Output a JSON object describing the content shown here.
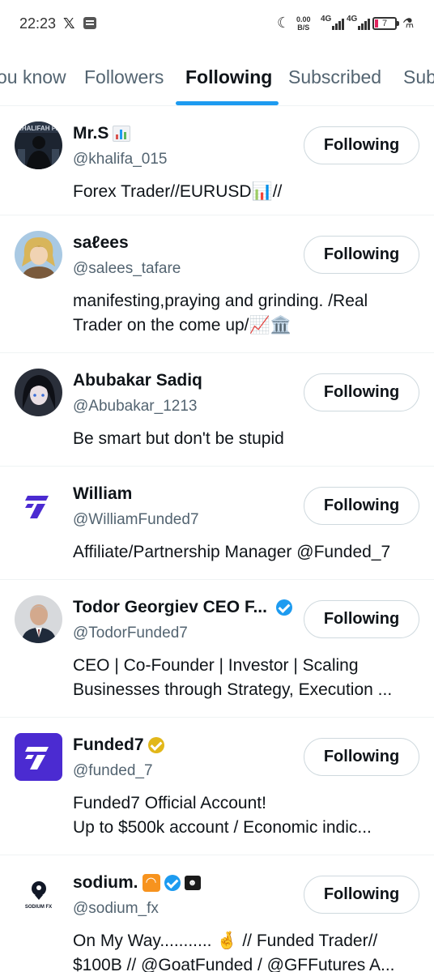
{
  "status_bar": {
    "time": "22:23",
    "x_icon": "x-logo-icon",
    "net_speed_value": "0.00",
    "net_speed_unit": "B/S",
    "network_1": "4G",
    "network_2": "4G",
    "battery": "7"
  },
  "tabs": [
    {
      "label": "ou know",
      "active": false
    },
    {
      "label": "Followers",
      "active": false
    },
    {
      "label": "Following",
      "active": true
    },
    {
      "label": "Subscribed",
      "active": false
    },
    {
      "label": "Sub",
      "active": false
    }
  ],
  "accent_color": "#1d9bf0",
  "users": [
    {
      "name": "Mr.S",
      "name_emoji": "chart-emoji",
      "handle": "@khalifa_015",
      "bio_lines": [
        "Forex Trader//EURUSD📊//"
      ],
      "button": "Following",
      "avatar_text": "KHALIFAH FX"
    },
    {
      "name": "saℓees",
      "handle": "@salees_tafare",
      "bio_lines": [
        "manifesting,praying and grinding. /Real",
        "Trader on the come up/📈🏛️"
      ],
      "button": "Following"
    },
    {
      "name": "Abubakar Sadiq",
      "handle": "@Abubakar_1213",
      "bio_lines": [
        "Be smart but don't be stupid"
      ],
      "button": "Following"
    },
    {
      "name": "William",
      "handle": "@WilliamFunded7",
      "bio_lines": [
        "Affiliate/Partnership Manager @Funded_7"
      ],
      "button": "Following"
    },
    {
      "name": "Todor Georgiev CEO F...",
      "verified": "blue",
      "handle": "@TodorFunded7",
      "bio_lines": [
        "CEO | Co-Founder | Investor | Scaling",
        "Businesses through Strategy, Execution ..."
      ],
      "button": "Following"
    },
    {
      "name": "Funded7",
      "verified": "gold",
      "handle": "@funded_7",
      "bio_lines": [
        "Funded7 Official Account!",
        "Up to $500k  account / Economic indic..."
      ],
      "button": "Following"
    },
    {
      "name": "sodium.",
      "verified": "blue",
      "handle": "@sodium_fx",
      "bio_lines": [
        "On My Way........... 🤞 // Funded Trader//",
        "$100B // @GoatFunded / @GFFutures A..."
      ],
      "button": "Following",
      "avatar_text": "SODIUM FX"
    }
  ]
}
